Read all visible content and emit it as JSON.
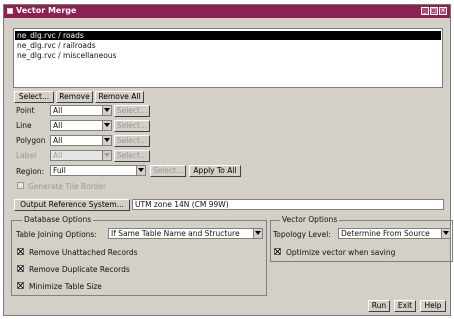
{
  "window": {
    "title": "Vector Merge",
    "menu_icon": "window-menu-icon",
    "title_buttons": [
      "_",
      "□",
      "×"
    ]
  },
  "layers": [
    {
      "label": "ne_dlg.rvc / roads",
      "selected": true
    },
    {
      "label": "ne_dlg.rvc / railroads",
      "selected": false
    },
    {
      "label": "ne_dlg.rvc / miscellaneous",
      "selected": false
    }
  ],
  "list_buttons": {
    "select": "Select...",
    "remove": "Remove",
    "remove_all": "Remove All"
  },
  "element_rows": [
    {
      "label": "Point",
      "value": "All",
      "button": "Select..."
    },
    {
      "label": "Line",
      "value": "All",
      "button": "Select..."
    },
    {
      "label": "Polygon",
      "value": "All",
      "button": "Select..."
    },
    {
      "label": "Label",
      "value": "All",
      "button": "Select...",
      "disabled": true
    }
  ],
  "region": {
    "label": "Region:",
    "value": "Full",
    "select": "Select...",
    "apply_all": "Apply To All"
  },
  "generate_tile_border": {
    "label": "Generate Tile Border",
    "checked": false,
    "disabled": true
  },
  "output_ref": {
    "button": "Output Reference System...",
    "value": "UTM zone 14N (CM 99W)"
  },
  "database_options": {
    "title": "Database Options",
    "table_joining_label": "Table Joining Options:",
    "table_joining_value": "If Same Table Name and Structure",
    "checkboxes": [
      {
        "label": "Remove Unattached Records",
        "checked": true
      },
      {
        "label": "Remove Duplicate Records",
        "checked": true
      },
      {
        "label": "Minimize Table Size",
        "checked": true
      }
    ]
  },
  "vector_options": {
    "title": "Vector Options",
    "topology_label": "Topology Level:",
    "topology_value": "Determine From Source",
    "optimize": {
      "label": "Optimize vector when saving",
      "checked": true
    }
  },
  "footer": {
    "run": "Run",
    "exit": "Exit",
    "help": "Help"
  }
}
